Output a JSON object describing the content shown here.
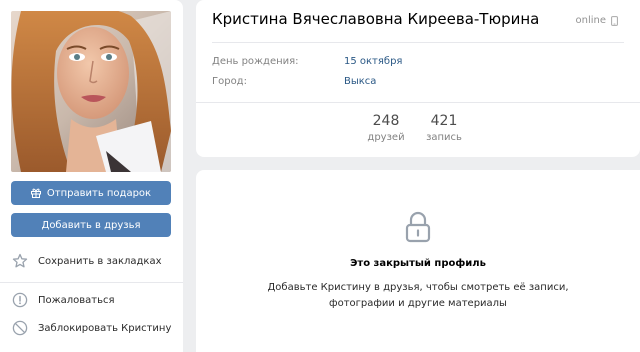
{
  "profile": {
    "full_name": "Кристина Вячеславовна Киреева-Тюрина",
    "status": "online"
  },
  "details": [
    {
      "label": "День рождения:",
      "value": "15 октября"
    },
    {
      "label": "Город:",
      "value": "Выкса"
    }
  ],
  "counters": [
    {
      "count": "248",
      "label": "друзей"
    },
    {
      "count": "421",
      "label": "запись"
    }
  ],
  "buttons": {
    "send_gift": "Отправить подарок",
    "add_friend": "Добавить в друзья"
  },
  "actions": {
    "bookmark": "Сохранить в закладках",
    "report": "Пожаловаться",
    "block": "Заблокировать Кристину"
  },
  "private": {
    "title": "Это закрытый профиль",
    "line1": "Добавьте Кристину в друзья, чтобы смотреть её записи,",
    "line2": "фотографии и другие материалы"
  },
  "colors": {
    "page_bg": "#edeef0",
    "accent": "#5181b8",
    "link": "#2a5885"
  },
  "icons": {
    "gift": "gift-icon",
    "star": "star-icon",
    "warning": "warning-icon",
    "block": "block-icon",
    "lock": "lock-icon",
    "phone": "phone-icon"
  }
}
